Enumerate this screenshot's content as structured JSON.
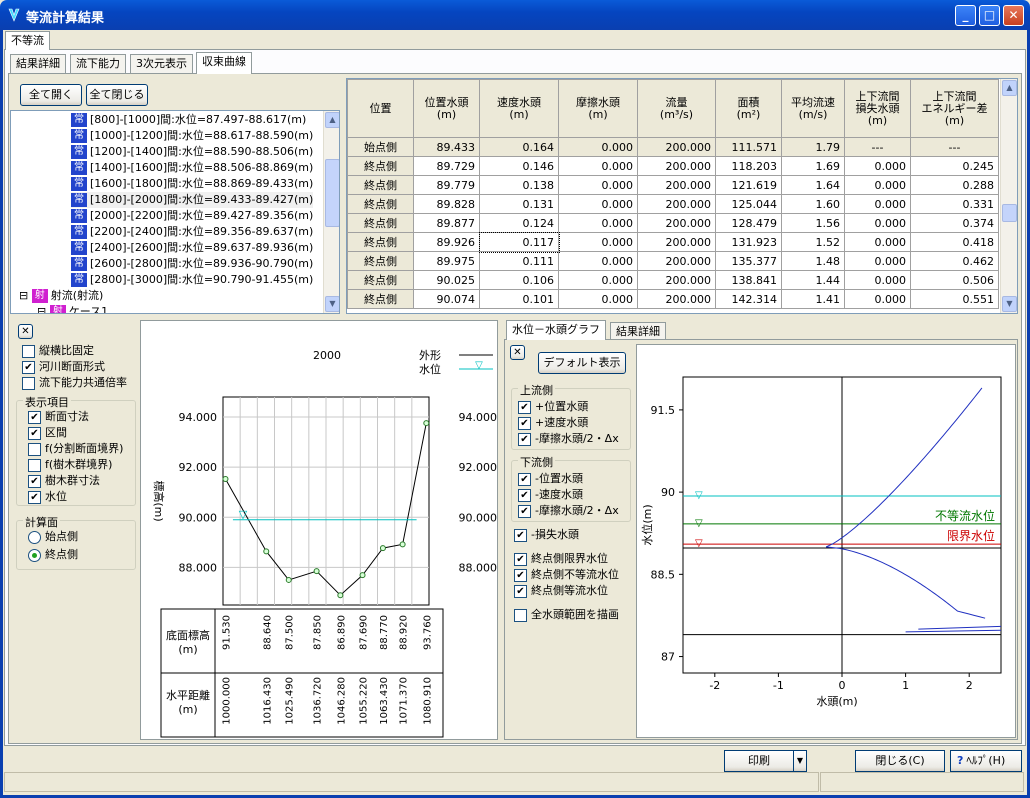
{
  "window": {
    "title": "等流計算結果",
    "min": "_",
    "max": "□",
    "close": "✕"
  },
  "outer_tab": "不等流",
  "inner_tabs": [
    "結果詳細",
    "流下能力",
    "3次元表示",
    "収束曲線"
  ],
  "tree": {
    "expand_all": "全て開く",
    "collapse_all": "全て閉じる",
    "kind_label": "常",
    "items": [
      "[800]-[1000]間:水位=87.497-88.617(m)",
      "[1000]-[1200]間:水位=88.617-88.590(m)",
      "[1200]-[1400]間:水位=88.590-88.506(m)",
      "[1400]-[1600]間:水位=88.506-88.869(m)",
      "[1600]-[1800]間:水位=88.869-89.433(m)",
      "[1800]-[2000]間:水位=89.433-89.427(m)",
      "[2000]-[2200]間:水位=89.427-89.356(m)",
      "[2200]-[2400]間:水位=89.356-89.637(m)",
      "[2400]-[2600]間:水位=89.637-89.936(m)",
      "[2600]-[2800]間:水位=89.936-90.790(m)",
      "[2800]-[3000]間:水位=90.790-91.455(m)"
    ],
    "group_label": "射",
    "group": "射流(射流)",
    "sub_item": "ケース1"
  },
  "table": {
    "headers": [
      "位置",
      "位置水頭\n(m)",
      "速度水頭\n(m)",
      "摩擦水頭\n(m)",
      "流量\n(m³/s)",
      "面積\n(m²)",
      "平均流速\n(m/s)",
      "上下流間\n損失水頭\n(m)",
      "上下流間\nエネルギー差\n(m)"
    ],
    "rows": [
      [
        "始点側",
        "89.433",
        "0.164",
        "0.000",
        "200.000",
        "111.571",
        "1.79",
        "---",
        "---"
      ],
      [
        "終点側",
        "89.729",
        "0.146",
        "0.000",
        "200.000",
        "118.203",
        "1.69",
        "0.000",
        "0.245"
      ],
      [
        "終点側",
        "89.779",
        "0.138",
        "0.000",
        "200.000",
        "121.619",
        "1.64",
        "0.000",
        "0.288"
      ],
      [
        "終点側",
        "89.828",
        "0.131",
        "0.000",
        "200.000",
        "125.044",
        "1.60",
        "0.000",
        "0.331"
      ],
      [
        "終点側",
        "89.877",
        "0.124",
        "0.000",
        "200.000",
        "128.479",
        "1.56",
        "0.000",
        "0.374"
      ],
      [
        "終点側",
        "89.926",
        "0.117",
        "0.000",
        "200.000",
        "131.923",
        "1.52",
        "0.000",
        "0.418"
      ],
      [
        "終点側",
        "89.975",
        "0.111",
        "0.000",
        "200.000",
        "135.377",
        "1.48",
        "0.000",
        "0.462"
      ],
      [
        "終点側",
        "90.025",
        "0.106",
        "0.000",
        "200.000",
        "138.841",
        "1.44",
        "0.000",
        "0.506"
      ],
      [
        "終点側",
        "90.074",
        "0.101",
        "0.000",
        "200.000",
        "142.314",
        "1.41",
        "0.000",
        "0.551"
      ]
    ]
  },
  "options": {
    "close": "✕",
    "fix_aspect": "縦横比固定",
    "river_section": "河川断面形式",
    "common_scale": "流下能力共通倍率",
    "display_group": "表示項目",
    "items": [
      "断面寸法",
      "区間",
      "f(分割断面境界)",
      "f(樹木群境界)",
      "樹木群寸法",
      "水位"
    ],
    "calc_group": "計算面",
    "radio_start": "始点側",
    "radio_end": "終点側"
  },
  "section_chart": {
    "title": "2000",
    "legend_outline": "外形",
    "legend_water": "水位",
    "ylabel": "標高(m)",
    "yticks": [
      "94.000",
      "92.000",
      "90.000",
      "88.000"
    ],
    "bed_label": "底面標高\n(m)",
    "dist_label": "水平距離\n(m)",
    "bed_values": [
      "91.530",
      "88.640",
      "87.500",
      "87.850",
      "86.890",
      "87.690",
      "88.770",
      "88.920",
      "93.760"
    ],
    "dist_values": [
      "1000.000",
      "1016.430",
      "1025.490",
      "1036.720",
      "1046.280",
      "1055.220",
      "1063.430",
      "1071.370",
      "1080.910"
    ]
  },
  "graph_tabs": [
    "水位－水頭グラフ",
    "結果詳細"
  ],
  "graph_options": {
    "close": "✕",
    "default_button": "デフォルト表示",
    "upstream": "上流側",
    "up_items": [
      "+位置水頭",
      "+速度水頭",
      "-摩擦水頭/2・Δx"
    ],
    "downstream": "下流側",
    "down_items": [
      "-位置水頭",
      "-速度水頭",
      "-摩擦水頭/2・Δx"
    ],
    "loss": "-損失水頭",
    "end_items": [
      "終点側限界水位",
      "終点側不等流水位",
      "終点側等流水位"
    ],
    "all_range": "全水頭範囲を描画"
  },
  "head_chart": {
    "ylabel": "水位(m)",
    "xlabel": "水頭(m)",
    "yticks": [
      "91.5",
      "90",
      "88.5",
      "87"
    ],
    "xticks": [
      "-2",
      "-1",
      "0",
      "1",
      "2"
    ],
    "label_nonuniform": "不等流水位",
    "label_critical": "限界水位"
  },
  "footer": {
    "print": "印刷",
    "close": "閉じる(C)",
    "help": "ﾍﾙﾌﾟ(H)"
  },
  "colors": {
    "nonuniform": "#007700",
    "critical": "#cc0000",
    "water": "#00c0c0",
    "curve": "#2030c0"
  }
}
